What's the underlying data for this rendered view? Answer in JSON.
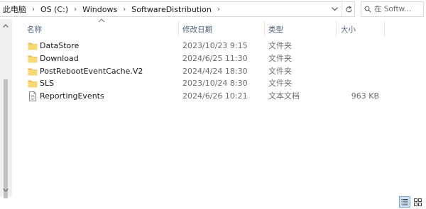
{
  "address_bar": {
    "crumbs": [
      "此电脑",
      "OS (C:)",
      "Windows",
      "SoftwareDistribution"
    ]
  },
  "search": {
    "placeholder": "在 Softw..."
  },
  "columns": {
    "name": "名称",
    "date_modified": "修改日期",
    "type": "类型",
    "size": "大小"
  },
  "files": [
    {
      "name": "DataStore",
      "date": "2023/10/23 9:15",
      "type": "文件夹",
      "size": "",
      "icon": "folder-icon"
    },
    {
      "name": "Download",
      "date": "2024/6/25 11:30",
      "type": "文件夹",
      "size": "",
      "icon": "folder-icon"
    },
    {
      "name": "PostRebootEventCache.V2",
      "date": "2024/4/24 18:30",
      "type": "文件夹",
      "size": "",
      "icon": "folder-icon"
    },
    {
      "name": "SLS",
      "date": "2023/10/24 8:30",
      "type": "文件夹",
      "size": "",
      "icon": "folder-icon"
    },
    {
      "name": "ReportingEvents",
      "date": "2024/6/26 10:21",
      "type": "文本文档",
      "size": "963 KB",
      "icon": "text-document-icon"
    }
  ],
  "colors": {
    "folder": "#f8d775",
    "folder_dark": "#e8b74a",
    "header_text": "#4c607a",
    "selection": "#cce4f7"
  }
}
